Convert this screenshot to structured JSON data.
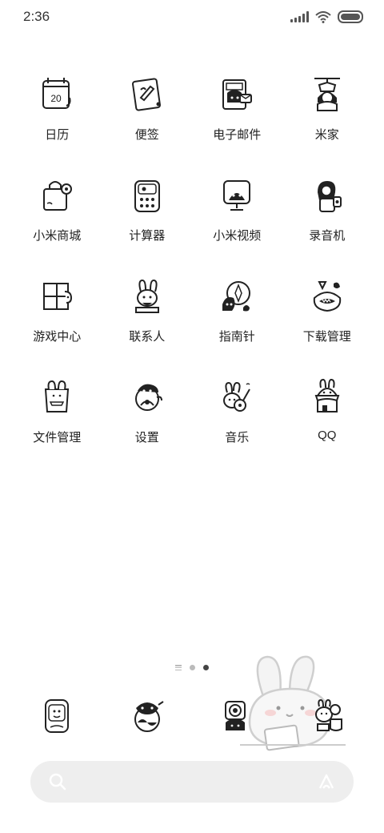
{
  "status_bar": {
    "time": "2:36"
  },
  "apps": [
    {
      "label": "日历",
      "icon": "calendar-icon",
      "badge": "20"
    },
    {
      "label": "便签",
      "icon": "notes-icon"
    },
    {
      "label": "电子邮件",
      "icon": "email-icon"
    },
    {
      "label": "米家",
      "icon": "mijia-icon"
    },
    {
      "label": "小米商城",
      "icon": "shopping-bag-icon"
    },
    {
      "label": "计算器",
      "icon": "calculator-icon"
    },
    {
      "label": "小米视频",
      "icon": "video-tv-icon"
    },
    {
      "label": "录音机",
      "icon": "recorder-icon"
    },
    {
      "label": "游戏中心",
      "icon": "game-blocks-icon"
    },
    {
      "label": "联系人",
      "icon": "contacts-bunny-icon"
    },
    {
      "label": "指南针",
      "icon": "compass-icon"
    },
    {
      "label": "下载管理",
      "icon": "download-icon"
    },
    {
      "label": "文件管理",
      "icon": "file-folder-icon"
    },
    {
      "label": "设置",
      "icon": "settings-icon"
    },
    {
      "label": "音乐",
      "icon": "music-guitar-icon"
    },
    {
      "label": "QQ",
      "icon": "qq-bunny-icon"
    }
  ],
  "page_indicator": {
    "pages": 2,
    "current": 2
  },
  "dock": [
    {
      "icon": "phone-icon"
    },
    {
      "icon": "messages-icon"
    },
    {
      "icon": "camera-icon"
    },
    {
      "icon": "browser-icon"
    }
  ]
}
